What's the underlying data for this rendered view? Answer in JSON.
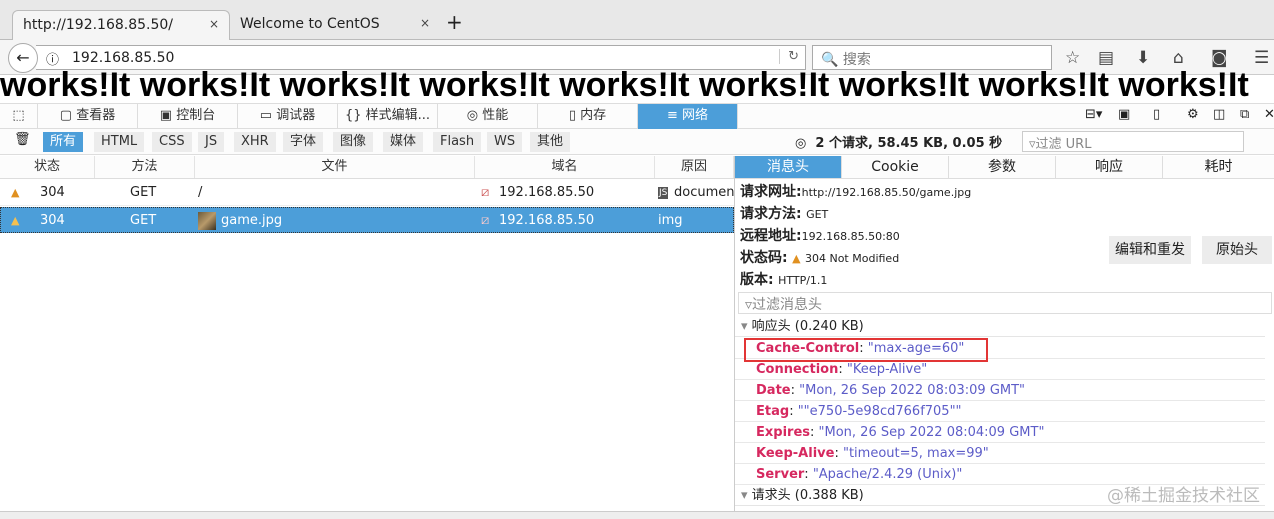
{
  "browser": {
    "tabs": [
      {
        "title": "http://192.168.85.50/"
      },
      {
        "title": "Welcome to CentOS"
      }
    ],
    "close": "×",
    "new_tab": "+",
    "url": "192.168.85.50",
    "search_placeholder": "搜索"
  },
  "page": {
    "text": "works!It works!It works!It works!It works!It works!It works!It works!It works!It"
  },
  "devtools": {
    "tools": [
      "查看器",
      "控制台",
      "调试器",
      "样式编辑...",
      "性能",
      "内存",
      "网络"
    ],
    "filters": [
      "所有",
      "HTML",
      "CSS",
      "JS",
      "XHR",
      "字体",
      "图像",
      "媒体",
      "Flash",
      "WS",
      "其他"
    ],
    "summary": "2 个请求, 58.45 KB, 0.05 秒",
    "url_filter_placeholder": "过滤 URL",
    "columns": [
      "状态",
      "方法",
      "文件",
      "域名",
      "原因"
    ],
    "rows": [
      {
        "status": "304",
        "method": "GET",
        "file": "/",
        "domain": "192.168.85.50",
        "cause": "documen"
      },
      {
        "status": "304",
        "method": "GET",
        "file": "game.jpg",
        "domain": "192.168.85.50",
        "cause": "img"
      }
    ],
    "panel": {
      "tabs": [
        "消息头",
        "Cookie",
        "参数",
        "响应",
        "耗时"
      ],
      "request_url_label": "请求网址:",
      "request_url": "http://192.168.85.50/game.jpg",
      "method_label": "请求方法:",
      "method": "GET",
      "remote_label": "远程地址:",
      "remote": "192.168.85.50:80",
      "status_label": "状态码:",
      "status": "304 Not Modified",
      "version_label": "版本:",
      "version": "HTTP/1.1",
      "edit_resend": "编辑和重发",
      "raw_headers": "原始头",
      "header_filter_placeholder": "过滤消息头",
      "response_group": "响应头 (0.240 KB)",
      "response_headers": [
        {
          "k": "Cache-Control",
          "v": "\"max-age=60\""
        },
        {
          "k": "Connection",
          "v": "\"Keep-Alive\""
        },
        {
          "k": "Date",
          "v": "\"Mon, 26 Sep 2022 08:03:09 GMT\""
        },
        {
          "k": "Etag",
          "v": "\"\"e750-5e98cd766f705\"\""
        },
        {
          "k": "Expires",
          "v": "\"Mon, 26 Sep 2022 08:04:09 GMT\""
        },
        {
          "k": "Keep-Alive",
          "v": "\"timeout=5, max=99\""
        },
        {
          "k": "Server",
          "v": "\"Apache/2.4.29 (Unix)\""
        }
      ],
      "request_group": "请求头 (0.388 KB)"
    }
  },
  "watermark": "@稀土掘金技术社区",
  "colors": {
    "accent": "#4c9ed9",
    "header_key": "#d6285f",
    "header_value": "#5c5cc8",
    "highlight": "#e23535"
  }
}
